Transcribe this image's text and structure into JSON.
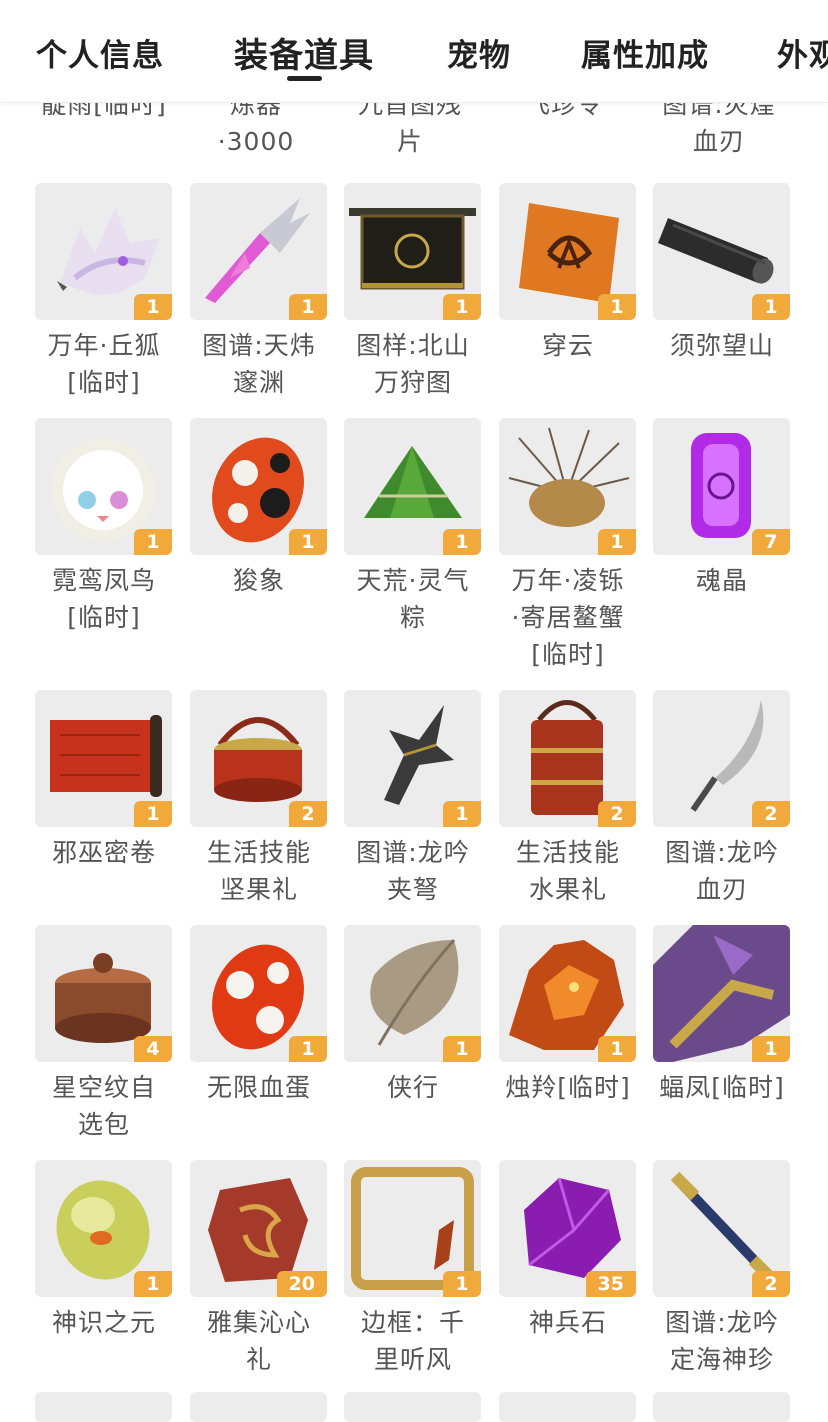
{
  "tabs": [
    {
      "label": "个人信息",
      "active": false
    },
    {
      "label": "装备道具",
      "active": true
    },
    {
      "label": "宠物",
      "active": false
    },
    {
      "label": "属性加成",
      "active": false
    },
    {
      "label": "外观",
      "active": false
    }
  ],
  "partial_row": [
    {
      "lines": [
        "靛雨[临时]"
      ]
    },
    {
      "lines": [
        "炼器",
        "·3000"
      ]
    },
    {
      "lines": [
        "九首图残",
        "片"
      ]
    },
    {
      "lines": [
        "飞珍令"
      ]
    },
    {
      "lines": [
        "图谱:灾煌",
        "血刃"
      ]
    }
  ],
  "items": [
    {
      "name_lines": [
        "万年·丘狐",
        "[临时]"
      ],
      "count": "1",
      "icon": "white-fox-icon"
    },
    {
      "name_lines": [
        "图谱:天炜",
        "邃渊"
      ],
      "count": "1",
      "icon": "crystal-blade-icon"
    },
    {
      "name_lines": [
        "图样:北山",
        "万狩图"
      ],
      "count": "1",
      "icon": "hanging-scroll-icon"
    },
    {
      "name_lines": [
        "穿云"
      ],
      "count": "1",
      "icon": "parchment-emblem-icon"
    },
    {
      "name_lines": [
        "须弥望山"
      ],
      "count": "1",
      "icon": "black-scroll-tube-icon"
    },
    {
      "name_lines": [
        "霓鸾凤鸟",
        "[临时]"
      ],
      "count": "1",
      "icon": "fluffy-bird-icon"
    },
    {
      "name_lines": [
        "狻象"
      ],
      "count": "1",
      "icon": "spotted-egg-icon"
    },
    {
      "name_lines": [
        "天荒·灵气",
        "粽"
      ],
      "count": "1",
      "icon": "rice-dumpling-icon"
    },
    {
      "name_lines": [
        "万年·凌铄",
        "·寄居鳌蟹",
        "[临时]"
      ],
      "count": "1",
      "icon": "spiky-crab-icon"
    },
    {
      "name_lines": [
        "魂晶"
      ],
      "count": "7",
      "icon": "purple-crystal-icon"
    },
    {
      "name_lines": [
        "邪巫密卷"
      ],
      "count": "1",
      "icon": "red-scroll-icon"
    },
    {
      "name_lines": [
        "生活技能",
        "坚果礼"
      ],
      "count": "2",
      "icon": "basket-icon"
    },
    {
      "name_lines": [
        "图谱:龙吟",
        "夹弩"
      ],
      "count": "1",
      "icon": "crossbow-icon"
    },
    {
      "name_lines": [
        "生活技能",
        "水果礼"
      ],
      "count": "2",
      "icon": "tiered-box-icon"
    },
    {
      "name_lines": [
        "图谱:龙吟",
        "血刃"
      ],
      "count": "2",
      "icon": "curved-blade-icon"
    },
    {
      "name_lines": [
        "星空纹自",
        "选包"
      ],
      "count": "4",
      "icon": "bronze-box-icon"
    },
    {
      "name_lines": [
        "无限血蛋"
      ],
      "count": "1",
      "icon": "red-egg-icon"
    },
    {
      "name_lines": [
        "侠行"
      ],
      "count": "1",
      "icon": "leaf-icon"
    },
    {
      "name_lines": [
        "烛羚[临时]"
      ],
      "count": "1",
      "icon": "fire-beast-icon"
    },
    {
      "name_lines": [
        "蝠凤[临时]"
      ],
      "count": "1",
      "icon": "purple-beast-icon"
    },
    {
      "name_lines": [
        "神识之元"
      ],
      "count": "1",
      "icon": "amber-orb-icon"
    },
    {
      "name_lines": [
        "雅集沁心",
        "礼"
      ],
      "count": "20",
      "icon": "red-stone-icon"
    },
    {
      "name_lines": [
        "边框：千",
        "里听风"
      ],
      "count": "1",
      "icon": "golden-frame-icon"
    },
    {
      "name_lines": [
        "神兵石"
      ],
      "count": "35",
      "icon": "purple-ore-icon"
    },
    {
      "name_lines": [
        "图谱:龙吟",
        "定海神珍"
      ],
      "count": "2",
      "icon": "staff-icon"
    }
  ],
  "colors": {
    "badge": "#f2a93b",
    "thumb_bg": "#ececec",
    "text": "#555555"
  }
}
